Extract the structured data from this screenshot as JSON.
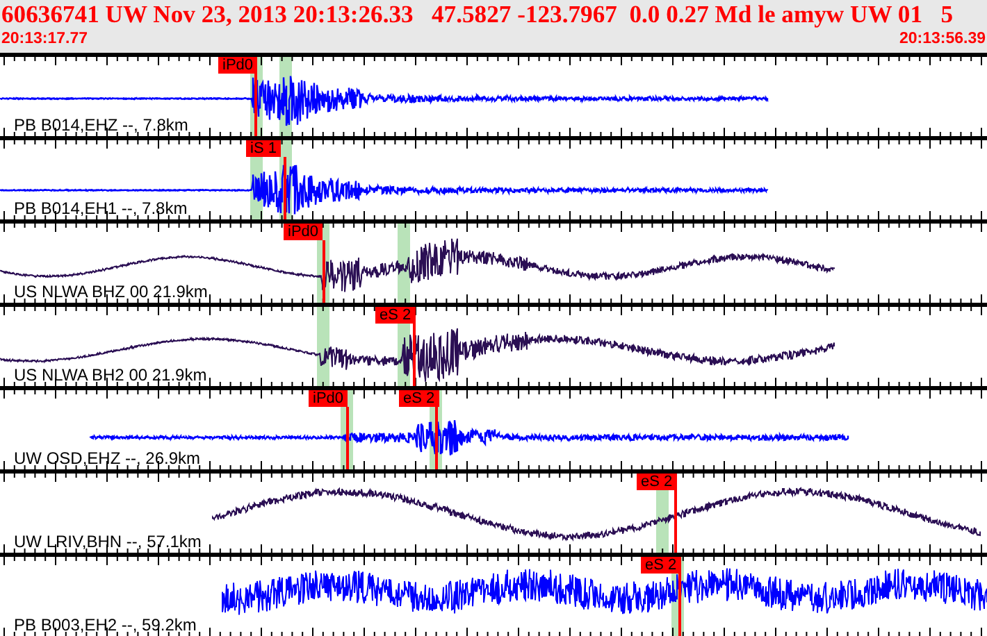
{
  "header": {
    "title": "60636741 UW Nov 23, 2013 20:13:26.33   47.5827 -123.7967  0.0 0.27 Md le amyw UW 01   5",
    "start_time": "20:13:17.77",
    "end_time": "20:13:56.39"
  },
  "panels": [
    {
      "station": "PB B014,EHZ --, 7.8km",
      "color": "#0000ff",
      "picks": [
        {
          "label": "iPd0"
        }
      ]
    },
    {
      "station": "PB B014,EH1 --, 7.8km",
      "color": "#0000ff",
      "picks": [
        {
          "label": "iS 1"
        }
      ]
    },
    {
      "station": "US NLWA BHZ 00 21.9km",
      "color": "#2b0f54",
      "picks": [
        {
          "label": "iPd0"
        }
      ]
    },
    {
      "station": "US NLWA BH2 00 21.9km",
      "color": "#2b0f54",
      "picks": [
        {
          "label": "eS 2"
        }
      ]
    },
    {
      "station": "UW OSD,EHZ --, 26.9km",
      "color": "#0000ff",
      "picks": [
        {
          "label": "iPd0"
        },
        {
          "label": "eS 2"
        }
      ]
    },
    {
      "station": "UW LRIV,BHN --, 57.1km",
      "color": "#2b0f54",
      "picks": [
        {
          "label": "eS 2"
        }
      ]
    },
    {
      "station": "PB B003,EH2 --, 59.2km",
      "color": "#0000ff",
      "picks": [
        {
          "label": "eS 2"
        }
      ]
    }
  ]
}
